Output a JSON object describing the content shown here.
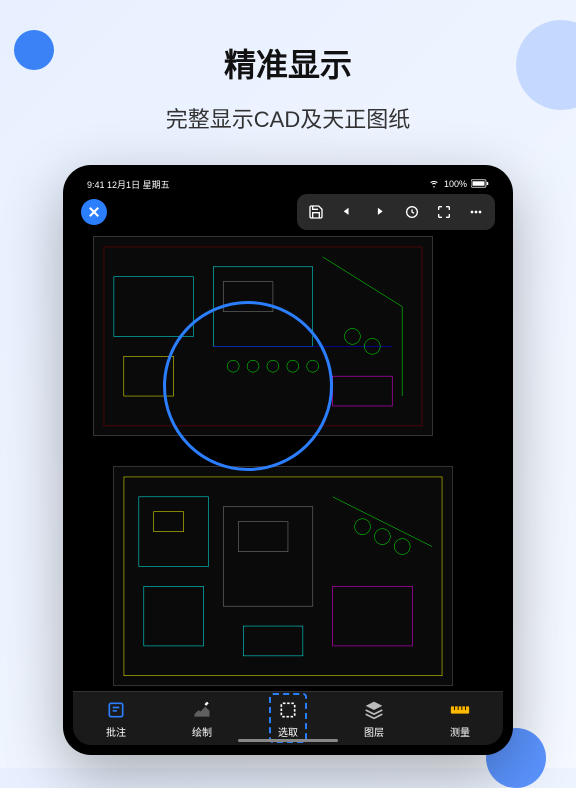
{
  "marketing": {
    "title": "精准显示",
    "subtitle": "完整显示CAD及天正图纸"
  },
  "statusbar": {
    "time": "9:41",
    "date": "12月1日 星期五",
    "battery": "100%"
  },
  "toolbar": {
    "icons": [
      "save-icon",
      "undo-icon",
      "redo-icon",
      "sync-icon",
      "fullscreen-icon",
      "more-icon"
    ]
  },
  "side_tools": {
    "bolt": "bolt-icon",
    "annotation": "annotation-icon"
  },
  "bottom_tabs": [
    {
      "label": "批注",
      "icon": "note-icon",
      "color": "#2b7fff"
    },
    {
      "label": "绘制",
      "icon": "draw-icon",
      "color": "#fff"
    },
    {
      "label": "选取",
      "icon": "select-icon",
      "color": "#fff",
      "active": true
    },
    {
      "label": "图层",
      "icon": "layers-icon",
      "color": "#fff"
    },
    {
      "label": "测量",
      "icon": "ruler-icon",
      "color": "#ffb800"
    }
  ]
}
